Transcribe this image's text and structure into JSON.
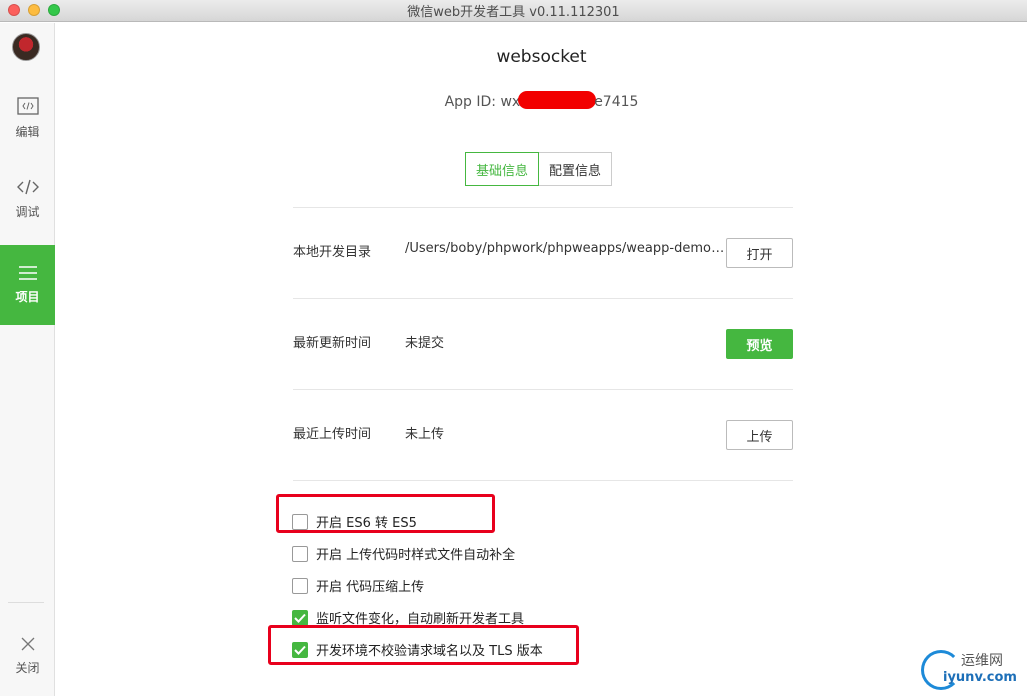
{
  "window": {
    "title": "微信web开发者工具 v0.11.112301"
  },
  "sidebar": {
    "items": [
      {
        "label": "编辑",
        "icon": "code-frame-icon"
      },
      {
        "label": "调试",
        "icon": "code-brackets-icon"
      },
      {
        "label": "项目",
        "icon": "menu-lines-icon"
      }
    ],
    "close_label": "关闭"
  },
  "project": {
    "name": "websocket",
    "appid_label": "App ID: wx",
    "appid_suffix": "e7415"
  },
  "tabs": [
    "基础信息",
    "配置信息"
  ],
  "rows": [
    {
      "label": "本地开发目录",
      "value": "/Users/boby/phpwork/phpweapps/weapp-demo-websocket",
      "button": "打开"
    },
    {
      "label": "最新更新时间",
      "value": "未提交",
      "button": "预览"
    },
    {
      "label": "最近上传时间",
      "value": "未上传",
      "button": "上传"
    }
  ],
  "options": [
    {
      "label": "开启 ES6 转 ES5",
      "checked": false
    },
    {
      "label": "开启 上传代码时样式文件自动补全",
      "checked": false
    },
    {
      "label": "开启 代码压缩上传",
      "checked": false
    },
    {
      "label": "监听文件变化，自动刷新开发者工具",
      "checked": true
    },
    {
      "label": "开发环境不校验请求域名以及 TLS 版本",
      "checked": true
    }
  ],
  "watermark": {
    "cn": "运维网",
    "en": "iyunv.com"
  },
  "colors": {
    "accent": "#45b740",
    "highlight": "#e8001c"
  }
}
